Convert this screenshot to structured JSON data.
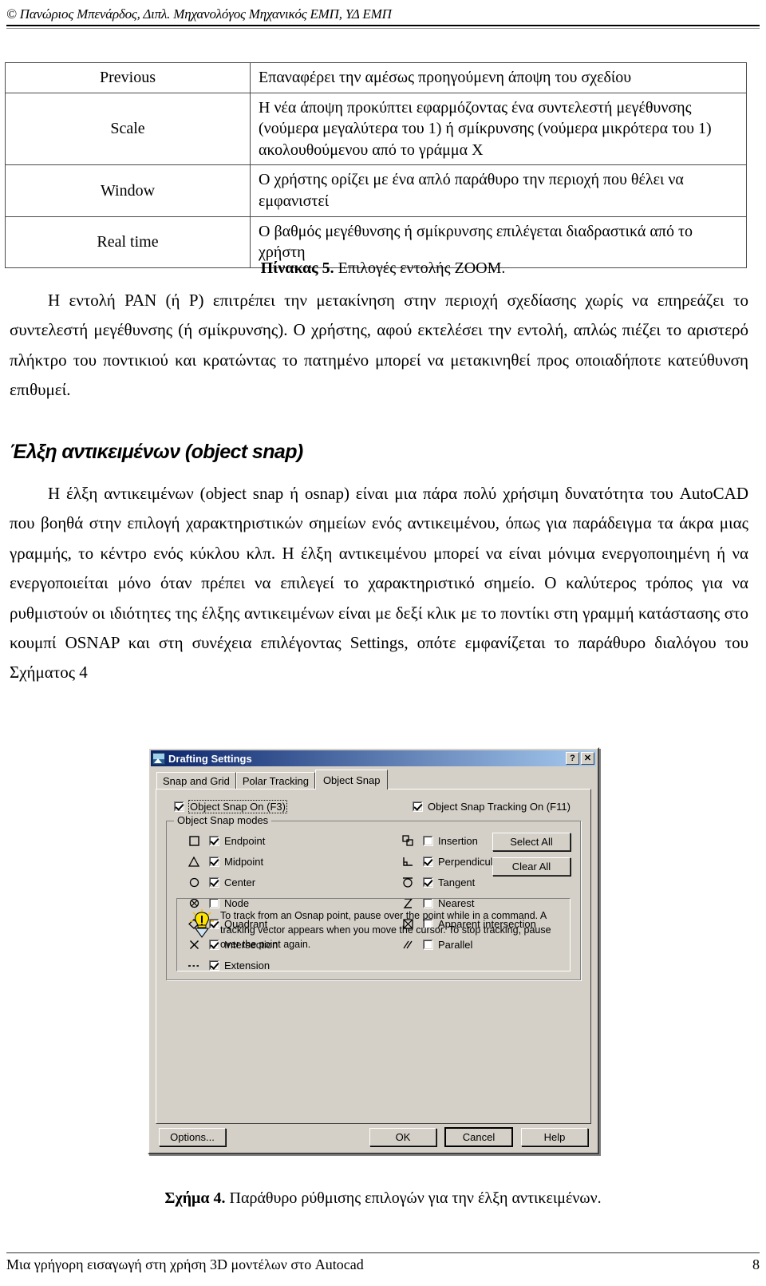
{
  "header": {
    "text": "© Πανώριος Μπενάρδος, Διπλ. Μηχανολόγος Μηχανικός ΕΜΠ, ΥΔ ΕΜΠ"
  },
  "zoom_table": {
    "rows": [
      {
        "option": "Previous",
        "description": "Επαναφέρει την αμέσως προηγούμενη άποψη του σχεδίου"
      },
      {
        "option": "Scale",
        "description": "Η νέα άποψη προκύπτει εφαρμόζοντας ένα συντελεστή μεγέθυνσης (νούμερα μεγαλύτερα του 1) ή σμίκρυνσης (νούμερα μικρότερα του 1) ακολουθούμενου από το γράμμα Χ"
      },
      {
        "option": "Window",
        "description": "Ο χρήστης ορίζει με ένα απλό παράθυρο την περιοχή που θέλει να εμφανιστεί"
      },
      {
        "option": "Real time",
        "description": "Ο βαθμός μεγέθυνσης ή σμίκρυνσης επιλέγεται διαδραστικά από το χρήστη"
      }
    ],
    "caption_label": "Πίνακας 5.",
    "caption_text": " Επιλογές εντολής ZOOM."
  },
  "paragraphs": {
    "pan": "Η εντολή PAN (ή P) επιτρέπει την μετακίνηση στην περιοχή σχεδίασης χωρίς να επηρεάζει το συντελεστή μεγέθυνσης (ή σμίκρυνσης). Ο χρήστης, αφού εκτελέσει την εντολή, απλώς πιέζει το αριστερό πλήκτρο του ποντικιού και κρατώντας το πατημένο μπορεί να μετακινηθεί προς οποιαδήποτε κατεύθυνση επιθυμεί.",
    "snap": "Η έλξη αντικειμένων (object snap ή osnap) είναι μια πάρα πολύ χρήσιμη δυνατότητα του AutoCAD που βοηθά στην επιλογή χαρακτηριστικών σημείων ενός αντικειμένου, όπως για παράδειγμα τα άκρα μιας γραμμής, το κέντρο ενός κύκλου κλπ. Η έλξη αντικειμένου μπορεί να είναι μόνιμα ενεργοποιημένη ή να ενεργοποιείται μόνο όταν πρέπει να επιλεγεί το χαρακτηριστικό σημείο. Ο καλύτερος τρόπος για να ρυθμιστούν οι ιδιότητες της έλξης αντικειμένων είναι με δεξί κλικ με το ποντίκι στη γραμμή κατάστασης στο κουμπί OSNAP και στη συνέχεια επιλέγοντας Settings, οπότε εμφανίζεται το παράθυρο διαλόγου του Σχήματος 4"
  },
  "section_heading": "Έλξη αντικειμένων (object snap)",
  "dialog": {
    "title": "Drafting Settings",
    "help_button": "?",
    "close_button": "✕",
    "tabs": [
      {
        "label": "Snap and Grid",
        "active": false
      },
      {
        "label": "Polar Tracking",
        "active": false
      },
      {
        "label": "Object Snap",
        "active": true
      }
    ],
    "object_snap_on": {
      "label": "Object Snap On (F3)",
      "checked": true
    },
    "object_snap_tracking_on": {
      "label": "Object Snap Tracking On (F11)",
      "checked": true
    },
    "modes_group_title": "Object Snap modes",
    "modes": [
      {
        "label": "Endpoint",
        "checked": true,
        "icon": "square-icon"
      },
      {
        "label": "Insertion",
        "checked": false,
        "icon": "insertion-icon"
      },
      {
        "label": "Midpoint",
        "checked": true,
        "icon": "triangle-icon"
      },
      {
        "label": "Perpendicular",
        "checked": true,
        "icon": "perpendicular-icon"
      },
      {
        "label": "Center",
        "checked": true,
        "icon": "circle-icon"
      },
      {
        "label": "Tangent",
        "checked": true,
        "icon": "tangent-icon"
      },
      {
        "label": "Node",
        "checked": false,
        "icon": "node-icon"
      },
      {
        "label": "Nearest",
        "checked": false,
        "icon": "nearest-icon"
      },
      {
        "label": "Quadrant",
        "checked": true,
        "icon": "diamond-icon"
      },
      {
        "label": "Apparent intersection",
        "checked": false,
        "icon": "apparent-intersection-icon"
      },
      {
        "label": "Intersection",
        "checked": true,
        "icon": "cross-icon"
      },
      {
        "label": "Parallel",
        "checked": false,
        "icon": "parallel-icon"
      },
      {
        "label": "Extension",
        "checked": true,
        "icon": "extension-icon"
      }
    ],
    "select_all_label": "Select All",
    "clear_all_label": "Clear All",
    "tip": "To track from an Osnap point, pause over the point while in a command.  A tracking vector appears when you move the cursor. To stop tracking, pause over the point again.",
    "buttons": {
      "options": "Options...",
      "ok": "OK",
      "cancel": "Cancel",
      "help": "Help"
    }
  },
  "figure_caption": {
    "label": "Σχήμα 4.",
    "text": " Παράθυρο ρύθμισης επιλογών για την έλξη αντικειμένων."
  },
  "footer": {
    "text": "Μια γρήγορη εισαγωγή στη χρήση 3D μοντέλων στο Autocad",
    "page_number": "8"
  }
}
